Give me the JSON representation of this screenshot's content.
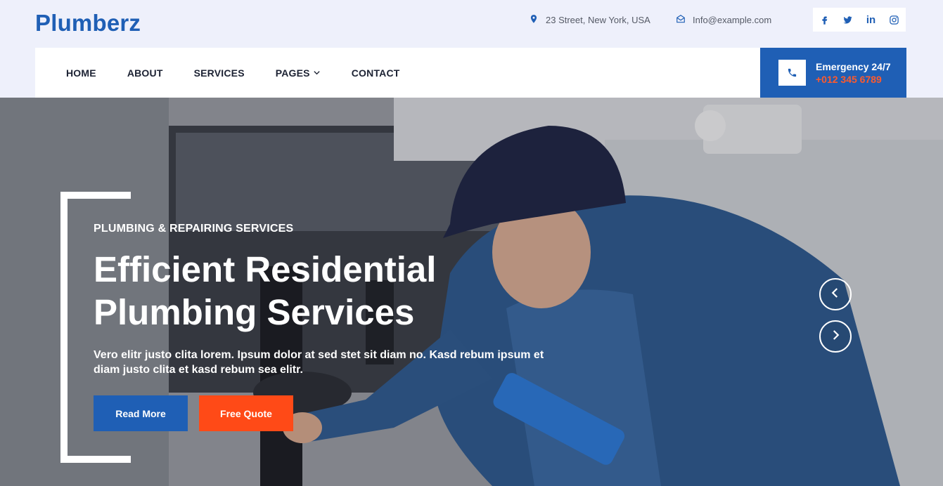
{
  "brand": {
    "name": "Plumberz",
    "color": "#1f5fb5"
  },
  "topbar": {
    "address": {
      "icon": "map-marker-icon",
      "text": "23 Street, New York, USA"
    },
    "email": {
      "icon": "envelope-icon",
      "text": "Info@example.com"
    },
    "socials": [
      {
        "icon": "facebook-icon",
        "label": "f"
      },
      {
        "icon": "twitter-icon",
        "label": ""
      },
      {
        "icon": "linkedin-icon",
        "label": "in"
      },
      {
        "icon": "instagram-icon",
        "label": ""
      }
    ]
  },
  "nav": {
    "items": [
      {
        "label": "HOME"
      },
      {
        "label": "ABOUT"
      },
      {
        "label": "SERVICES"
      },
      {
        "label": "PAGES",
        "has_dropdown": true
      },
      {
        "label": "CONTACT"
      }
    ]
  },
  "emergency": {
    "icon": "phone-icon",
    "title": "Emergency 24/7",
    "phone": "+012 345 6789",
    "bg_color": "#1f5fb5",
    "phone_color": "#ff5a2c"
  },
  "hero": {
    "eyebrow": "PLUMBING & REPAIRING SERVICES",
    "headline_line1": "Efficient Residential",
    "headline_line2": "Plumbing Services",
    "lead": "Vero elitr justo clita lorem. Ipsum dolor at sed stet sit diam no. Kasd rebum ipsum et diam justo clita et kasd rebum sea elitr.",
    "primary_button": "Read More",
    "secondary_button": "Free Quote",
    "primary_color": "#1f5fb5",
    "secondary_color": "#ff4a17",
    "carousel": {
      "prev_icon": "chevron-left-icon",
      "next_icon": "chevron-right-icon"
    }
  }
}
